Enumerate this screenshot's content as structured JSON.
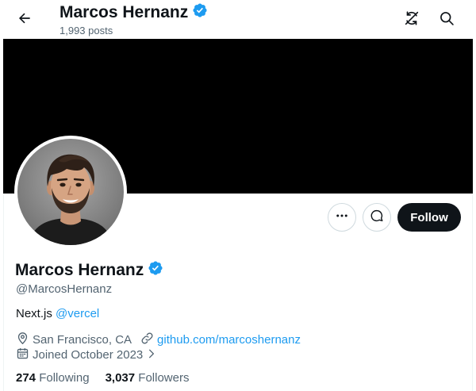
{
  "header": {
    "name": "Marcos Hernanz",
    "posts": "1,993 posts"
  },
  "icons": {
    "back": "back-arrow-icon",
    "sync": "sync-off-icon",
    "search": "search-icon",
    "verified": "verified-badge-icon",
    "more": "more-dots-icon",
    "message": "message-bubble-icon",
    "location": "location-pin-icon",
    "link": "link-icon",
    "calendar": "calendar-icon"
  },
  "colors": {
    "accent": "#1d9bf0",
    "text": "#0f1419",
    "secondary": "#536471",
    "banner": "#000000",
    "follow_button": "#0f1419"
  },
  "profile": {
    "display_name": "Marcos Hernanz",
    "handle": "@MarcosHernanz",
    "bio_text": "Next.js",
    "bio_mention": "@vercel",
    "location": "San Francisco, CA",
    "website": "github.com/marcoshernanz",
    "joined": "Joined October 2023"
  },
  "actions": {
    "follow_label": "Follow"
  },
  "stats": {
    "following_count": "274",
    "following_label": "Following",
    "followers_count": "3,037",
    "followers_label": "Followers"
  }
}
